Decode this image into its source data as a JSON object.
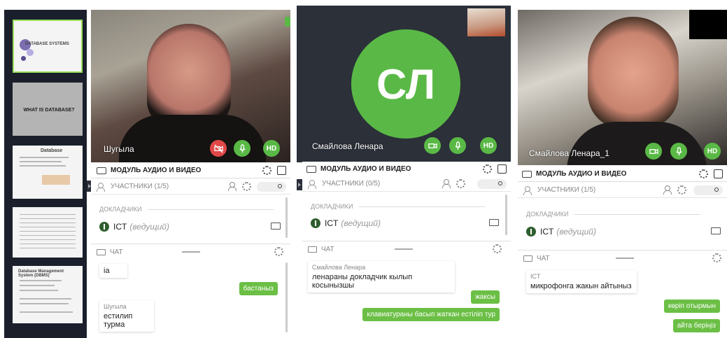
{
  "colors": {
    "accent_green": "#5ab946",
    "mute_red": "#e04848",
    "dark_panel": "#2b3039",
    "slide_border": "#9be15d"
  },
  "slides": [
    {
      "title": "Database Systems"
    },
    {
      "title": "What is database?"
    },
    {
      "title": "Database"
    },
    {
      "title": ""
    },
    {
      "title": "Database Management System (DBMS)"
    }
  ],
  "panel1": {
    "video_name": "Шугыла",
    "hd_label": "HD",
    "module_title": "МОДУЛЬ АУДИО И ВИДЕО",
    "participants_title": "УЧАСТНИКИ (1/5)",
    "section_presenters": "ДОКЛАДЧИКИ",
    "presenter_name": "ICT",
    "presenter_role": "(ведущий)",
    "chat_title": "ЧАТ",
    "messages": [
      {
        "type": "in",
        "author": "",
        "text": "ia"
      },
      {
        "type": "out",
        "text": "бастаныз"
      },
      {
        "type": "in",
        "author": "Шугыла",
        "text": "естилип турма"
      }
    ]
  },
  "panel2": {
    "avatar_initials": "СЛ",
    "video_name": "Смайлова Ленара",
    "hd_label": "HD",
    "module_title": "МОДУЛЬ АУДИО И ВИДЕО",
    "participants_title": "УЧАСТНИКИ (0/5)",
    "section_presenters": "ДОКЛАДЧИКИ",
    "presenter_name": "ICT",
    "presenter_role": "(ведущий)",
    "chat_title": "ЧАТ",
    "messages": [
      {
        "type": "in",
        "author": "Смайлова Ленара",
        "text": "ленараны докладчик кылып косынызшы"
      },
      {
        "type": "out",
        "text": "жаксы"
      },
      {
        "type": "out",
        "text": "клавиатураны басып жаткан естіліп тур"
      }
    ]
  },
  "panel3": {
    "video_name": "Смайлова Ленара_1",
    "hd_label": "HD",
    "module_title": "МОДУЛЬ АУДИО И ВИДЕО",
    "participants_title": "УЧАСТНИКИ (1/5)",
    "section_presenters": "ДОКЛАДЧИКИ",
    "presenter_name": "ICT",
    "presenter_role": "(ведущий)",
    "chat_title": "ЧАТ",
    "messages": [
      {
        "type": "in",
        "author": "ICT",
        "text": "микрофонга жакын айтыныз"
      },
      {
        "type": "out",
        "text": "көріп отырмын"
      },
      {
        "type": "out",
        "text": "айта беріңіз"
      }
    ]
  }
}
